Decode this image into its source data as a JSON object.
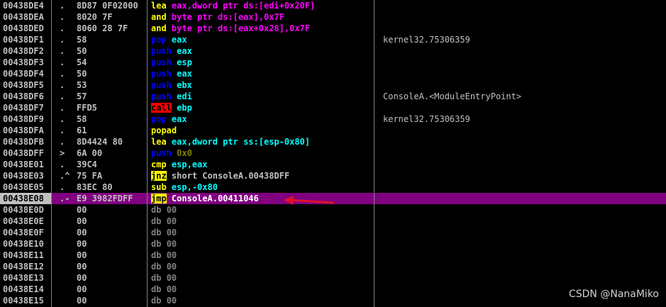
{
  "rows": [
    {
      "addr": "00438DE4",
      "mark": ".",
      "bytes": "8D87 0F02000",
      "mnem": "lea",
      "mnem_color": "#ffff00",
      "mnem_bg": "",
      "ops": "eax,dword ptr ds:[edi+0x20F]",
      "ops_color": "#ff00ff",
      "comment": "",
      "selected": false
    },
    {
      "addr": "00438DEA",
      "mark": ".",
      "bytes": "8020 7F",
      "mnem": "and",
      "mnem_color": "#ffff00",
      "mnem_bg": "",
      "ops": "byte ptr ds:[eax],0x7F",
      "ops_color": "#ff00ff",
      "comment": "",
      "selected": false
    },
    {
      "addr": "00438DED",
      "mark": ".",
      "bytes": "8060 28 7F",
      "mnem": "and",
      "mnem_color": "#ffff00",
      "mnem_bg": "",
      "ops": "byte ptr ds:[eax+0x28],0x7F",
      "ops_color": "#ff00ff",
      "comment": "",
      "selected": false
    },
    {
      "addr": "00438DF1",
      "mark": ".",
      "bytes": "58",
      "mnem": "pop",
      "mnem_color": "#0000ff",
      "mnem_bg": "",
      "ops": "eax",
      "ops_color": "#00ffff",
      "comment": "kernel32.75306359",
      "selected": false
    },
    {
      "addr": "00438DF2",
      "mark": ".",
      "bytes": "50",
      "mnem": "push",
      "mnem_color": "#0000ff",
      "mnem_bg": "",
      "ops": "eax",
      "ops_color": "#00ffff",
      "comment": "",
      "selected": false
    },
    {
      "addr": "00438DF3",
      "mark": ".",
      "bytes": "54",
      "mnem": "push",
      "mnem_color": "#0000ff",
      "mnem_bg": "",
      "ops": "esp",
      "ops_color": "#00ffff",
      "comment": "",
      "selected": false
    },
    {
      "addr": "00438DF4",
      "mark": ".",
      "bytes": "50",
      "mnem": "push",
      "mnem_color": "#0000ff",
      "mnem_bg": "",
      "ops": "eax",
      "ops_color": "#00ffff",
      "comment": "",
      "selected": false
    },
    {
      "addr": "00438DF5",
      "mark": ".",
      "bytes": "53",
      "mnem": "push",
      "mnem_color": "#0000ff",
      "mnem_bg": "",
      "ops": "ebx",
      "ops_color": "#00ffff",
      "comment": "",
      "selected": false
    },
    {
      "addr": "00438DF6",
      "mark": ".",
      "bytes": "57",
      "mnem": "push",
      "mnem_color": "#0000ff",
      "mnem_bg": "",
      "ops": "edi",
      "ops_color": "#00ffff",
      "comment": "ConsoleA.<ModuleEntryPoint>",
      "selected": false
    },
    {
      "addr": "00438DF7",
      "mark": ".",
      "bytes": "FFD5",
      "mnem": "call",
      "mnem_color": "#000000",
      "mnem_bg": "#ff0000",
      "ops": "ebp",
      "ops_color": "#00ffff",
      "comment": "",
      "selected": false
    },
    {
      "addr": "00438DF9",
      "mark": ".",
      "bytes": "58",
      "mnem": "pop",
      "mnem_color": "#0000ff",
      "mnem_bg": "",
      "ops": "eax",
      "ops_color": "#00ffff",
      "comment": "kernel32.75306359",
      "selected": false
    },
    {
      "addr": "00438DFA",
      "mark": ".",
      "bytes": "61",
      "mnem": "popad",
      "mnem_color": "#ffff00",
      "mnem_bg": "",
      "ops": "",
      "ops_color": "#c0c0c0",
      "comment": "",
      "selected": false
    },
    {
      "addr": "00438DFB",
      "mark": ".",
      "bytes": "8D4424 80",
      "mnem": "lea",
      "mnem_color": "#ffff00",
      "mnem_bg": "",
      "ops": "eax,dword ptr ss:[esp-0x80]",
      "ops_color": "#00ffff",
      "comment": "",
      "selected": false
    },
    {
      "addr": "00438DFF",
      "mark": ">",
      "bytes": "6A 00",
      "mnem": "push",
      "mnem_color": "#0000ff",
      "mnem_bg": "",
      "ops": "0x0",
      "ops_color": "#808000",
      "comment": "",
      "selected": false
    },
    {
      "addr": "00438E01",
      "mark": ".",
      "bytes": "39C4",
      "mnem": "cmp",
      "mnem_color": "#ffff00",
      "mnem_bg": "",
      "ops": "esp,eax",
      "ops_color": "#00ffff",
      "comment": "",
      "selected": false
    },
    {
      "addr": "00438E03",
      "mark": ".^",
      "bytes": "75 FA",
      "mnem": "jnz",
      "mnem_color": "#000000",
      "mnem_bg": "#ffff00",
      "ops": "short ConsoleA.00438DFF",
      "ops_color": "#c0c0c0",
      "comment": "",
      "selected": false
    },
    {
      "addr": "00438E05",
      "mark": ".",
      "bytes": "83EC 80",
      "mnem": "sub",
      "mnem_color": "#ffff00",
      "mnem_bg": "",
      "ops": "esp,-0x80",
      "ops_color": "#00ffff",
      "comment": "",
      "selected": false
    },
    {
      "addr": "00438E08",
      "mark": ".-",
      "bytes": "E9 3982FDFF",
      "mnem": "jmp",
      "mnem_color": "#000000",
      "mnem_bg": "#ffff00",
      "ops": "ConsoleA.00411046",
      "ops_color": "#ffffff",
      "comment": "",
      "selected": true
    },
    {
      "addr": "00438E0D",
      "mark": "",
      "bytes": "00",
      "mnem": "db",
      "mnem_color": "#808080",
      "mnem_bg": "",
      "ops": "00",
      "ops_color": "#808080",
      "comment": "",
      "selected": false
    },
    {
      "addr": "00438E0E",
      "mark": "",
      "bytes": "00",
      "mnem": "db",
      "mnem_color": "#808080",
      "mnem_bg": "",
      "ops": "00",
      "ops_color": "#808080",
      "comment": "",
      "selected": false
    },
    {
      "addr": "00438E0F",
      "mark": "",
      "bytes": "00",
      "mnem": "db",
      "mnem_color": "#808080",
      "mnem_bg": "",
      "ops": "00",
      "ops_color": "#808080",
      "comment": "",
      "selected": false
    },
    {
      "addr": "00438E10",
      "mark": "",
      "bytes": "00",
      "mnem": "db",
      "mnem_color": "#808080",
      "mnem_bg": "",
      "ops": "00",
      "ops_color": "#808080",
      "comment": "",
      "selected": false
    },
    {
      "addr": "00438E11",
      "mark": "",
      "bytes": "00",
      "mnem": "db",
      "mnem_color": "#808080",
      "mnem_bg": "",
      "ops": "00",
      "ops_color": "#808080",
      "comment": "",
      "selected": false
    },
    {
      "addr": "00438E12",
      "mark": "",
      "bytes": "00",
      "mnem": "db",
      "mnem_color": "#808080",
      "mnem_bg": "",
      "ops": "00",
      "ops_color": "#808080",
      "comment": "",
      "selected": false
    },
    {
      "addr": "00438E13",
      "mark": "",
      "bytes": "00",
      "mnem": "db",
      "mnem_color": "#808080",
      "mnem_bg": "",
      "ops": "00",
      "ops_color": "#808080",
      "comment": "",
      "selected": false
    },
    {
      "addr": "00438E14",
      "mark": "",
      "bytes": "00",
      "mnem": "db",
      "mnem_color": "#808080",
      "mnem_bg": "",
      "ops": "00",
      "ops_color": "#808080",
      "comment": "",
      "selected": false
    },
    {
      "addr": "00438E15",
      "mark": "",
      "bytes": "00",
      "mnem": "db",
      "mnem_color": "#808080",
      "mnem_bg": "",
      "ops": "00",
      "ops_color": "#808080",
      "comment": "",
      "selected": false
    }
  ],
  "watermark": "CSDN @NanaMiko",
  "colors": {
    "background": "#000000",
    "selection": "#800080",
    "arrow": "#e0102a"
  }
}
